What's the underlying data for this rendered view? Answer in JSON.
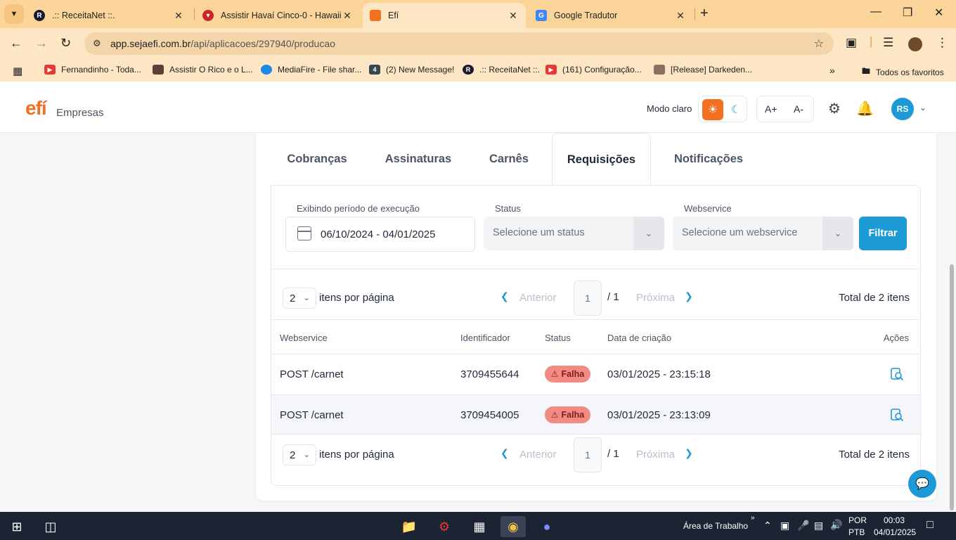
{
  "browser": {
    "tabs": [
      {
        "title": ".:: ReceitaNet ::.",
        "fav_color": "#1a1a2e"
      },
      {
        "title": "Assistir Havaí Cinco-0 - Hawaii Five-0",
        "fav_color": "#c62828"
      },
      {
        "title": "Efí",
        "fav_color": "#f37021"
      },
      {
        "title": "Google Tradutor",
        "fav_color": "#4285f4"
      }
    ],
    "url_host": "app.sejaefi.com.br",
    "url_path": "/api/aplicacoes/297940/producao",
    "bookmarks": [
      {
        "label": "Fernandinho - Toda...",
        "color": "#e53935"
      },
      {
        "label": "Assistir O Rico e o L...",
        "color": "#5d4037"
      },
      {
        "label": "MediaFire - File shar...",
        "color": "#1e88e5"
      },
      {
        "label": "(2) New Message!",
        "color": "#37474f"
      },
      {
        "label": ".:: ReceitaNet ::.",
        "color": "#1a1a2e"
      },
      {
        "label": "(161) Configuração...",
        "color": "#e53935"
      },
      {
        "label": "[Release] Darkeden...",
        "color": "#8d6e63"
      }
    ],
    "all_bookmarks": "Todos os favoritos"
  },
  "header": {
    "logo_mark": "efí",
    "logo_sub": "Empresas",
    "mode_label": "Modo claro",
    "font_increase": "A+",
    "font_decrease": "A-",
    "avatar_initials": "RS"
  },
  "tabs": [
    "Cobranças",
    "Assinaturas",
    "Carnês",
    "Requisições",
    "Notificações"
  ],
  "active_tab": "Requisições",
  "filters": {
    "period_label": "Exibindo período de execução",
    "period_value": "06/10/2024 - 04/01/2025",
    "status_label": "Status",
    "status_placeholder": "Selecione um status",
    "webservice_label": "Webservice",
    "webservice_placeholder": "Selecione um webservice",
    "filter_button": "Filtrar"
  },
  "pagination": {
    "per_page": "2",
    "per_page_label": "itens por página",
    "prev": "Anterior",
    "page": "1",
    "of_pages": "/ 1",
    "next": "Próxima",
    "total": "Total de 2 itens"
  },
  "table": {
    "headers": {
      "webservice": "Webservice",
      "id": "Identificador",
      "status": "Status",
      "created": "Data de criação",
      "actions": "Ações"
    },
    "rows": [
      {
        "webservice": "POST /carnet",
        "id": "3709455644",
        "status": "Falha",
        "created": "03/01/2025 - 23:15:18"
      },
      {
        "webservice": "POST /carnet",
        "id": "3709454005",
        "status": "Falha",
        "created": "03/01/2025 - 23:13:09"
      }
    ]
  },
  "taskbar": {
    "desktop_label": "Área de Trabalho",
    "lang_1": "POR",
    "lang_2": "PTB",
    "time": "00:03",
    "date": "04/01/2025"
  }
}
